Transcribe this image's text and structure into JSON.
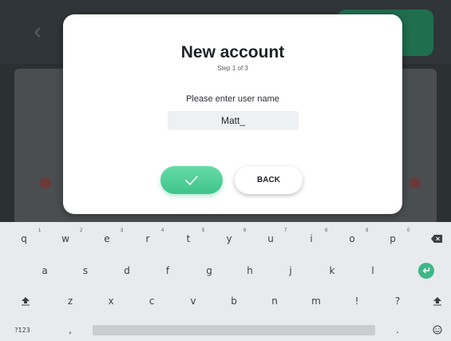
{
  "dialog": {
    "title": "New account",
    "step": "Step 1 of 3",
    "prompt": "Please enter user name",
    "input_value": "Matt_",
    "back_label": "BACK"
  },
  "keyboard": {
    "row1": [
      {
        "key": "q",
        "hint": "1"
      },
      {
        "key": "w",
        "hint": "2"
      },
      {
        "key": "e",
        "hint": "3"
      },
      {
        "key": "r",
        "hint": "4"
      },
      {
        "key": "t",
        "hint": "5"
      },
      {
        "key": "y",
        "hint": "6"
      },
      {
        "key": "u",
        "hint": "7"
      },
      {
        "key": "i",
        "hint": "8"
      },
      {
        "key": "o",
        "hint": "9"
      },
      {
        "key": "p",
        "hint": "0"
      }
    ],
    "row2": [
      "a",
      "s",
      "d",
      "f",
      "g",
      "h",
      "j",
      "k",
      "l"
    ],
    "row3": [
      "z",
      "x",
      "c",
      "v",
      "b",
      "n",
      "m",
      "!",
      "?"
    ],
    "symbols_label": "?123",
    "comma": ",",
    "period": ".",
    "accent_color": "#3fb68a"
  }
}
